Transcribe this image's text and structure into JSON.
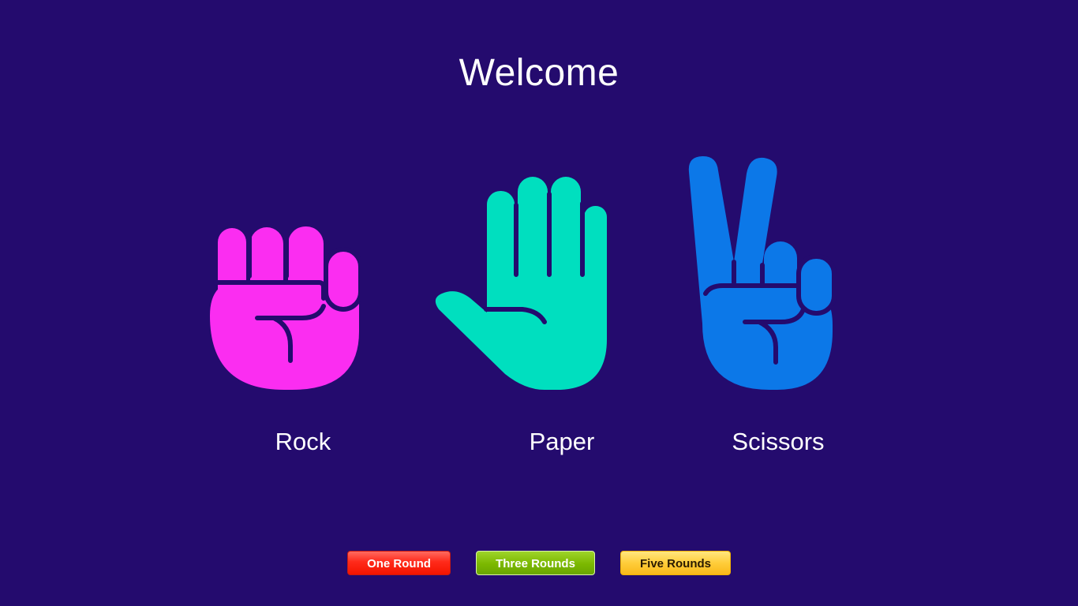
{
  "header": {
    "title": "Welcome"
  },
  "choices": [
    {
      "label": "Rock",
      "icon": "fist-icon",
      "color": "#fb2df1"
    },
    {
      "label": "Paper",
      "icon": "open-hand-icon",
      "color": "#00dfbf"
    },
    {
      "label": "Scissors",
      "icon": "peace-hand-icon",
      "color": "#0c78e8"
    }
  ],
  "rounds": {
    "one_label": "One Round",
    "three_label": "Three Rounds",
    "five_label": "Five Rounds"
  },
  "theme": {
    "background": "#240b6e",
    "text": "#ffffff",
    "one_button": "#ff2a1a",
    "three_button": "#7bb800",
    "five_button": "#ffcd3a"
  }
}
